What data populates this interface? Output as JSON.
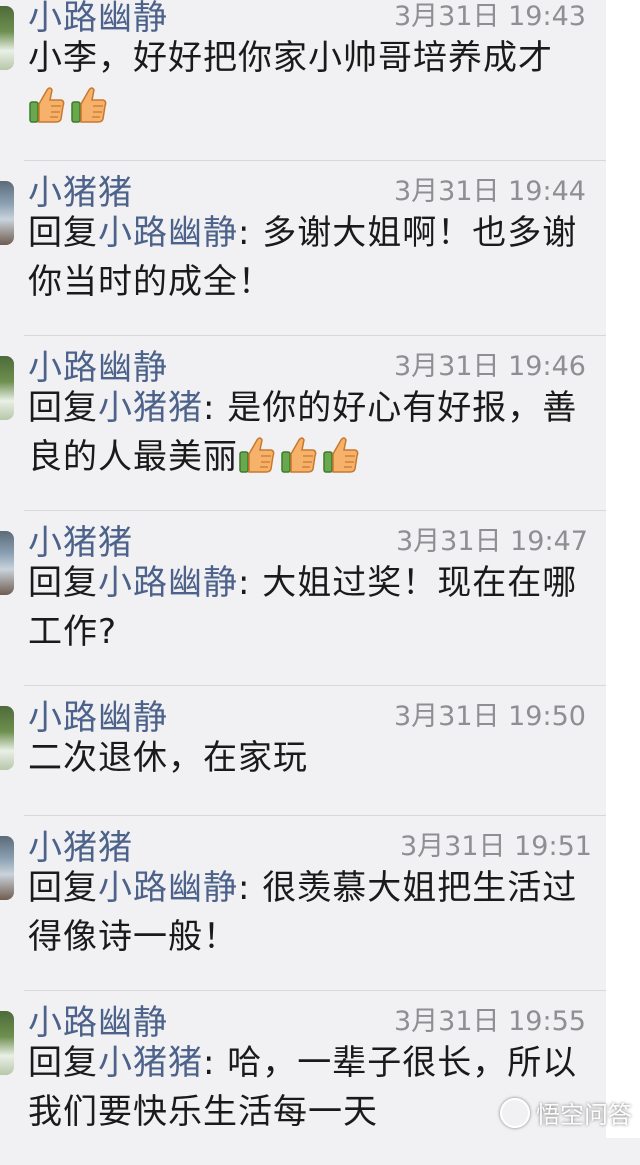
{
  "messages": [
    {
      "name": "小路幽静",
      "time": "3月31日 19:43",
      "reply_to": "",
      "text": "小李，好好把你家小帅哥培养成才",
      "thumbs": 2,
      "avatar": "green"
    },
    {
      "name": "小猪猪",
      "time": "3月31日 19:44",
      "reply_to": "小路幽静",
      "reply_prefix": "回复",
      "text": ": 多谢大姐啊！也多谢你当时的成全！",
      "thumbs": 0,
      "avatar": "blue"
    },
    {
      "name": "小路幽静",
      "time": "3月31日 19:46",
      "reply_to": "小猪猪",
      "reply_prefix": "回复",
      "text": ": 是你的好心有好报，善良的人最美丽",
      "thumbs": 3,
      "avatar": "green"
    },
    {
      "name": "小猪猪",
      "time": "3月31日 19:47",
      "reply_to": "小路幽静",
      "reply_prefix": "回复",
      "text": ": 大姐过奖！现在在哪工作?",
      "thumbs": 0,
      "avatar": "blue"
    },
    {
      "name": "小路幽静",
      "time": "3月31日 19:50",
      "reply_to": "",
      "text": "二次退休，在家玩",
      "thumbs": 0,
      "avatar": "green"
    },
    {
      "name": "小猪猪",
      "time": "3月31日 19:51",
      "reply_to": "小路幽静",
      "reply_prefix": "回复",
      "text": ": 很羡慕大姐把生活过得像诗一般！",
      "thumbs": 0,
      "avatar": "blue"
    },
    {
      "name": "小路幽静",
      "time": "3月31日 19:55",
      "reply_to": "小猪猪",
      "reply_prefix": "回复",
      "text": ": 哈，一辈子很长，所以我们要快乐生活每一天",
      "thumbs": 0,
      "avatar": "green"
    }
  ],
  "watermark": {
    "text": "悟空问答"
  },
  "icons": {
    "thumb": "thumbs-up-icon",
    "logo": "wukong-logo-icon"
  },
  "colors": {
    "name": "#4c628a",
    "text": "#1a1a1a",
    "time": "#8e8e93",
    "background": "#f1f1f3"
  }
}
